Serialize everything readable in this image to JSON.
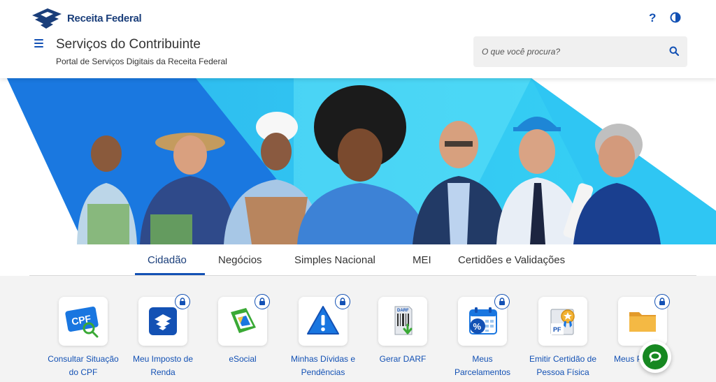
{
  "header": {
    "logo_text": "Receita Federal",
    "help_label": "?",
    "title": "Serviços do Contribuinte",
    "subtitle": "Portal de Serviços Digitais da Receita Federal",
    "search_placeholder": "O que você procura?"
  },
  "icons": {
    "menu": "menu-icon",
    "help": "help-icon",
    "contrast": "contrast-icon",
    "search": "search-icon",
    "lock": "lock-icon",
    "chat": "chat-icon"
  },
  "colors": {
    "brand_blue": "#1351b4",
    "dark_blue": "#1a3e7a",
    "banner_cyan": "#2ec4f1",
    "banner_blue": "#1976e0",
    "chat_green": "#168821"
  },
  "tabs": [
    {
      "label": "Cidadão",
      "active": true
    },
    {
      "label": "Negócios",
      "active": false
    },
    {
      "label": "Simples Nacional",
      "active": false
    },
    {
      "label": "MEI",
      "active": false
    },
    {
      "label": "Certidões e Validações",
      "active": false
    }
  ],
  "services": [
    {
      "line1": "Consultar Situação",
      "line2": "do CPF",
      "locked": false,
      "icon": "cpf-card-icon"
    },
    {
      "line1": "Meu Imposto de",
      "line2": "Renda",
      "locked": true,
      "icon": "income-tax-icon"
    },
    {
      "line1": "eSocial",
      "line2": "",
      "locked": true,
      "icon": "esocial-icon"
    },
    {
      "line1": "Minhas Dívidas e",
      "line2": "Pendências",
      "locked": true,
      "icon": "warning-triangle-icon"
    },
    {
      "line1": "Gerar DARF",
      "line2": "",
      "locked": false,
      "icon": "darf-document-icon"
    },
    {
      "line1": "Meus",
      "line2": "Parcelamentos",
      "locked": true,
      "icon": "calendar-percent-icon"
    },
    {
      "line1": "Emitir Certidão de",
      "line2": "Pessoa Física",
      "locked": false,
      "icon": "certificate-pf-icon"
    },
    {
      "line1": "Meus P",
      "line2": "",
      "locked": true,
      "icon": "folder-icon"
    }
  ]
}
